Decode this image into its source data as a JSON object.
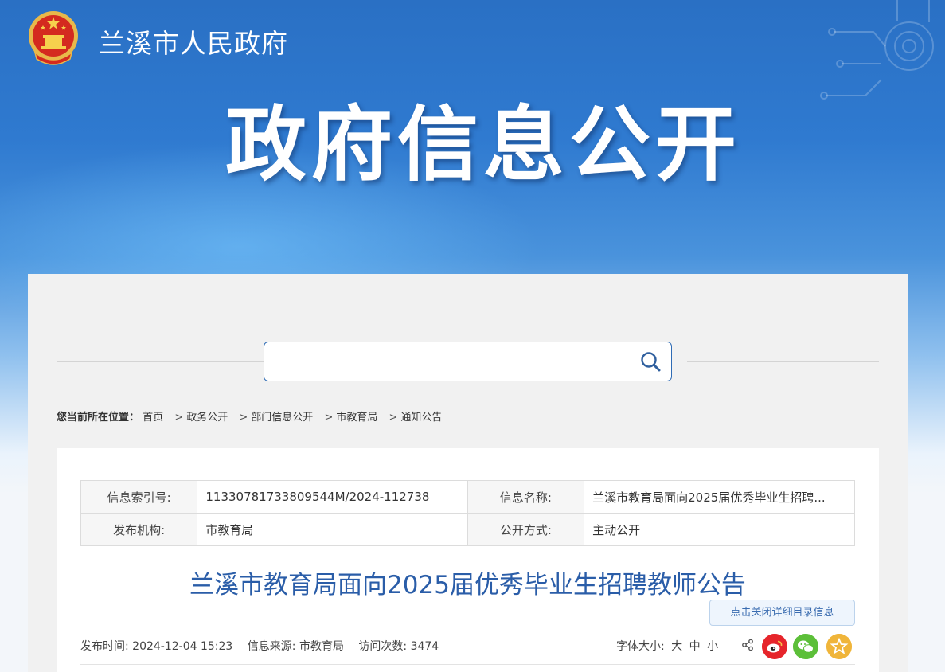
{
  "header": {
    "site_name": "兰溪市人民政府",
    "banner_title": "政府信息公开"
  },
  "search": {
    "placeholder": "",
    "icon": "search-icon"
  },
  "breadcrumb": {
    "lead": "您当前所在位置：",
    "items": [
      "首页",
      "政务公开",
      "部门信息公开",
      "市教育局",
      "通知公告"
    ]
  },
  "meta_table": {
    "index_label": "信息索引号:",
    "index_value": "11330781733809544M/2024-112738",
    "name_label": "信息名称:",
    "name_value": "兰溪市教育局面向2025届优秀毕业生招聘...",
    "org_label": "发布机构:",
    "org_value": "市教育局",
    "mode_label": "公开方式:",
    "mode_value": "主动公开"
  },
  "article": {
    "title": "兰溪市教育局面向2025届优秀毕业生招聘教师公告",
    "toggle_label": "点击关闭详细目录信息",
    "publish_time": "发布时间:  2024-12-04 15:23",
    "source": "信息来源:  市教育局",
    "visits": "访问次数: 3474",
    "font_size_label": "字体大小:",
    "font_large": "大",
    "font_medium": "中",
    "font_small": "小"
  },
  "colors": {
    "brand_blue": "#2f7ad0",
    "title_blue": "#2a5da8",
    "weibo": "#e6252b",
    "wechat": "#5cbf39",
    "favorite": "#f0b53a"
  }
}
